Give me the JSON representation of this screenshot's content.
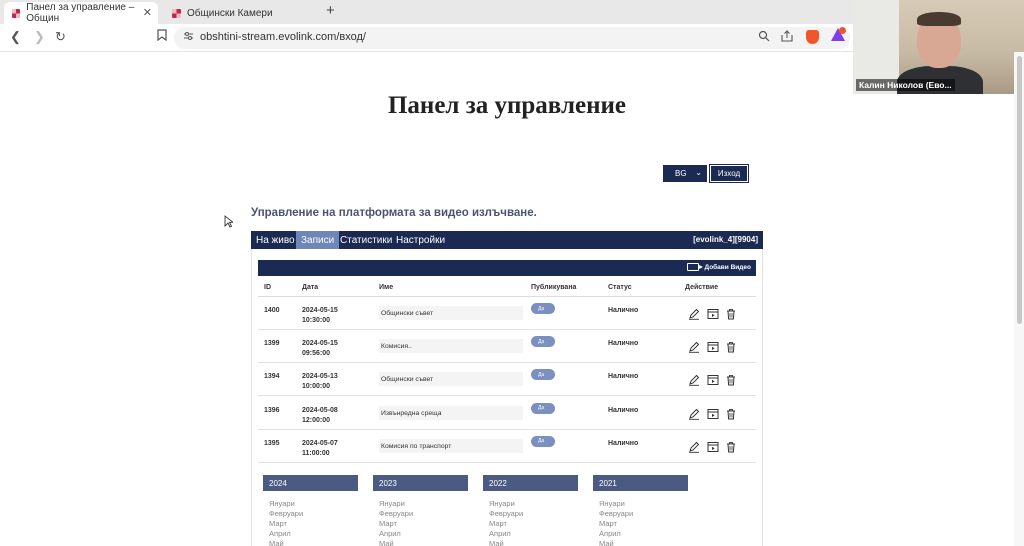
{
  "browser": {
    "tabs": [
      {
        "title": "Панел за управление – Общин"
      },
      {
        "title": "Общински Камери"
      }
    ],
    "url": "obshtini-stream.evolink.com/вход/"
  },
  "video_call": {
    "participant_name": "Калин Николов (Ево..."
  },
  "page": {
    "title": "Панел за управление",
    "language": "BG",
    "logout_label": "Изход",
    "section_heading": "Управление на платформата за видео излъчване."
  },
  "nav": {
    "items": [
      {
        "label": "На живо"
      },
      {
        "label": "Записи"
      },
      {
        "label": "Статистики"
      },
      {
        "label": "Настройки"
      }
    ],
    "account": "[evolink_4][9904]"
  },
  "recordings": {
    "add_label": "Добави Видео",
    "columns": [
      "ID",
      "Дата",
      "Име",
      "Публикувана",
      "Статус",
      "Действие"
    ],
    "rows": [
      {
        "id": "1400",
        "date": "2024-05-15",
        "time": "10:30:00",
        "name": "Общински съвет",
        "published": "Да",
        "status": "Налично"
      },
      {
        "id": "1399",
        "date": "2024-05-15",
        "time": "09:56:00",
        "name": "Комисия..",
        "published": "Да",
        "status": "Налично"
      },
      {
        "id": "1394",
        "date": "2024-05-13",
        "time": "10:00:00",
        "name": "Общински съвет",
        "published": "Да",
        "status": "Налично"
      },
      {
        "id": "1396",
        "date": "2024-05-08",
        "time": "12:00:00",
        "name": "Извънредна среща",
        "published": "Да",
        "status": "Налично"
      },
      {
        "id": "1395",
        "date": "2024-05-07",
        "time": "11:00:00",
        "name": "Комисия по транспорт",
        "published": "Да",
        "status": "Налично"
      }
    ]
  },
  "archive": {
    "years": [
      {
        "year": "2024",
        "months": [
          "Януари",
          "Февруари",
          "Март",
          "Април",
          "Май"
        ]
      },
      {
        "year": "2023",
        "months": [
          "Януари",
          "Февруари",
          "Март",
          "Април",
          "Май"
        ]
      },
      {
        "year": "2022",
        "months": [
          "Януари",
          "Февруари",
          "Март",
          "Април",
          "Май"
        ]
      },
      {
        "year": "2021",
        "months": [
          "Януари",
          "Февруари",
          "Март",
          "Април",
          "Май"
        ]
      }
    ]
  }
}
